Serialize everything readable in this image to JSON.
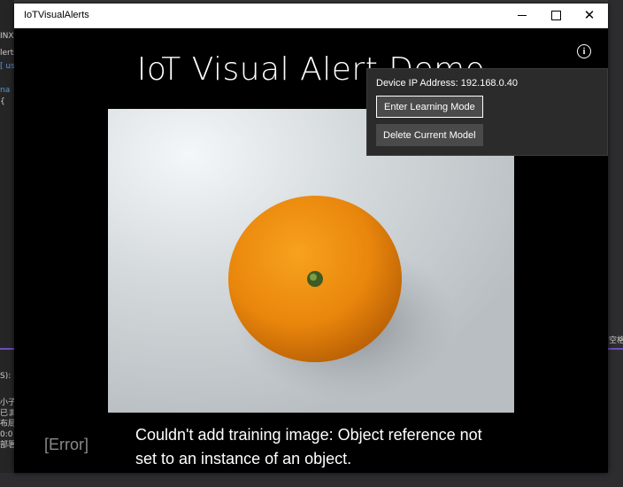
{
  "window": {
    "title": "IoTVisualAlerts"
  },
  "app": {
    "heading": "IoT Visual Alert Demo",
    "status_label": "[Error]",
    "error_message": "Couldn't add training image: Object reference not set to an instance of an object."
  },
  "flyout": {
    "ip_label": "Device IP Address: 192.168.0.40",
    "buttons": {
      "learning": "Enter Learning Mode",
      "delete": "Delete Current Model"
    }
  },
  "camera": {
    "subject": "orange"
  },
  "background": {
    "left_fragments": [
      "INX",
      "lerts",
      "[ us",
      "na",
      "{",
      "小子",
      "已まっ",
      "布局",
      "0:0",
      "部署",
      "S):"
    ],
    "right_fragments": [
      "空格"
    ]
  },
  "colors": {
    "window_bg": "#000000",
    "flyout_bg": "#2b2b2b",
    "button_bg": "#4a4a4a",
    "accent": "#6b4fbb"
  }
}
